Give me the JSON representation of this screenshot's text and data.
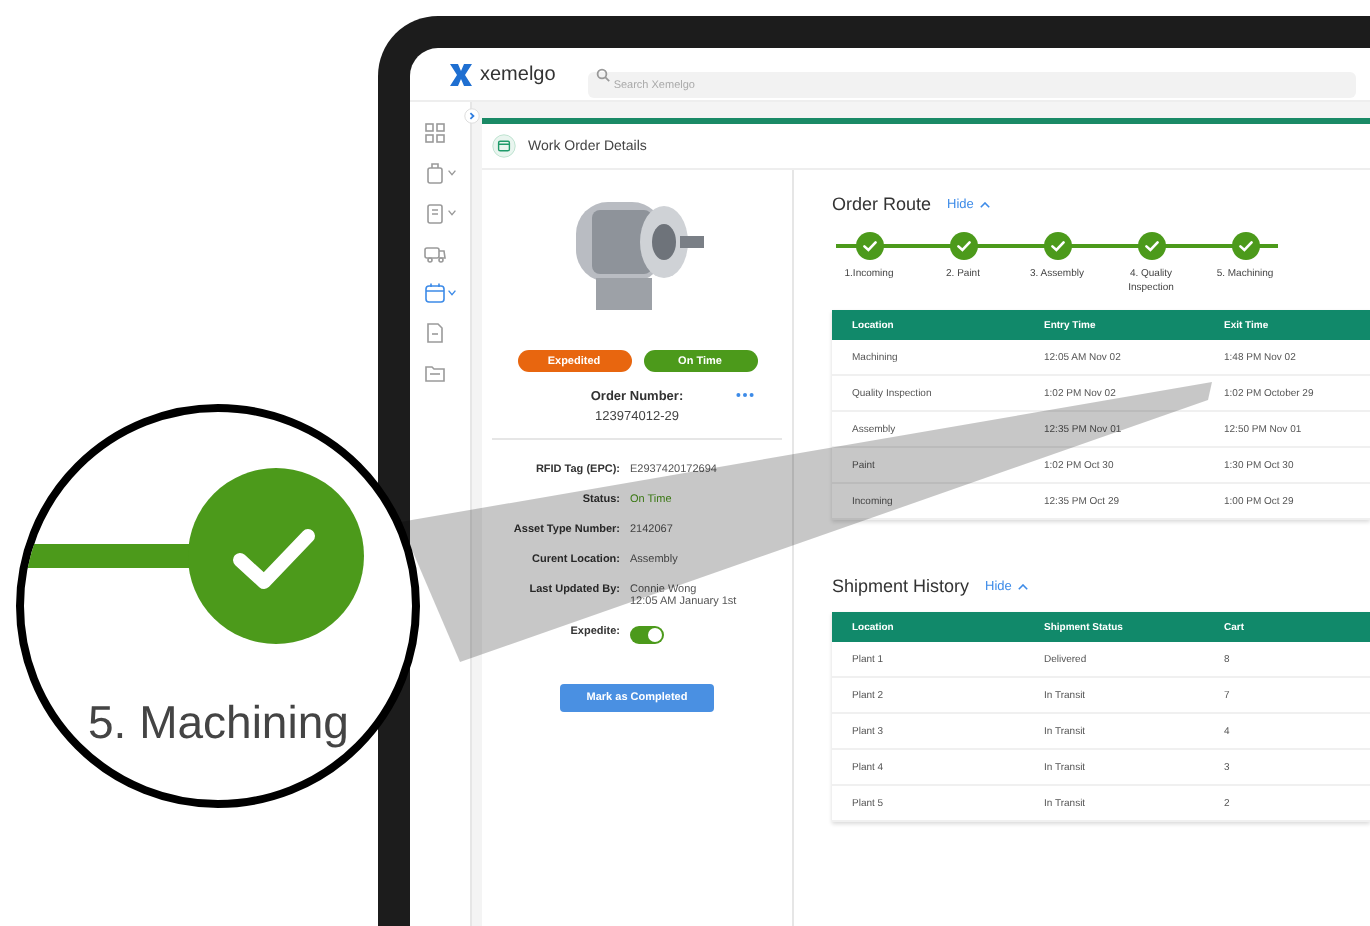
{
  "app": {
    "logo": "xemelgo",
    "search": {
      "placeholder": "Search Xemelgo"
    }
  },
  "sidebar": {
    "items": [
      {
        "expandable": false,
        "selected": false
      },
      {
        "expandable": true,
        "selected": false
      },
      {
        "expandable": true,
        "selected": false
      },
      {
        "expandable": false,
        "selected": false
      },
      {
        "expandable": true,
        "selected": true
      },
      {
        "expandable": false,
        "selected": false
      },
      {
        "expandable": false,
        "selected": false
      }
    ]
  },
  "page": {
    "title": "Work Order Details"
  },
  "order": {
    "badges": [
      {
        "label": "Expedited",
        "color": "#e8660f"
      },
      {
        "label": "On Time",
        "color": "#4c9a1b"
      }
    ],
    "number_label": "Order Number:",
    "number": "123974012-29",
    "details": [
      {
        "kind": "text",
        "label": "RFID Tag (EPC):",
        "value": "E2937420172694"
      },
      {
        "kind": "status",
        "label": "Status:",
        "value": "On Time"
      },
      {
        "kind": "text",
        "label": "Asset Type Number:",
        "value": "2142067"
      },
      {
        "kind": "text",
        "label": "Curent Location:",
        "value": "Assembly"
      },
      {
        "kind": "multiline",
        "label": "Last Updated By:",
        "value": "Connie Wong",
        "value_2": "12:05 AM January 1st"
      },
      {
        "kind": "toggle",
        "label": "Expedite:",
        "on": true
      }
    ],
    "action": "Mark as Completed"
  },
  "order_route": {
    "title": "Order Route",
    "toggle": "Hide",
    "steps": [
      {
        "label": "1.Incoming",
        "completed": true
      },
      {
        "label": "2. Paint",
        "completed": true
      },
      {
        "label": "3. Assembly",
        "completed": true
      },
      {
        "label": "4. Quality Inspection",
        "completed": true
      },
      {
        "label": "5. Machining",
        "completed": true
      }
    ],
    "table": {
      "columns": [
        "Location",
        "Entry Time",
        "Exit Time"
      ],
      "rows": [
        [
          "Machining",
          "12:05 AM Nov 02",
          "1:48 PM Nov 02"
        ],
        [
          "Quality Inspection",
          "1:02 PM Nov 02",
          "1:02 PM October 29"
        ],
        [
          "Assembly",
          "12:35 PM Nov 01",
          "12:50 PM Nov 01"
        ],
        [
          "Paint",
          "1:02 PM Oct 30",
          "1:30 PM Oct 30"
        ],
        [
          "Incoming",
          "12:35 PM Oct 29",
          "1:00 PM Oct 29"
        ]
      ]
    }
  },
  "shipment_history": {
    "title": "Shipment History",
    "toggle": "Hide",
    "table": {
      "columns": [
        "Location",
        "Shipment Status",
        "Cart"
      ],
      "rows": [
        [
          "Plant 1",
          "Delivered",
          "8"
        ],
        [
          "Plant 2",
          "In Transit",
          "7"
        ],
        [
          "Plant 3",
          "In Transit",
          "4"
        ],
        [
          "Plant 4",
          "In Transit",
          "3"
        ],
        [
          "Plant 5",
          "In Transit",
          "2"
        ]
      ]
    }
  },
  "magnifier": {
    "label": "5. Machining",
    "completed": true
  }
}
